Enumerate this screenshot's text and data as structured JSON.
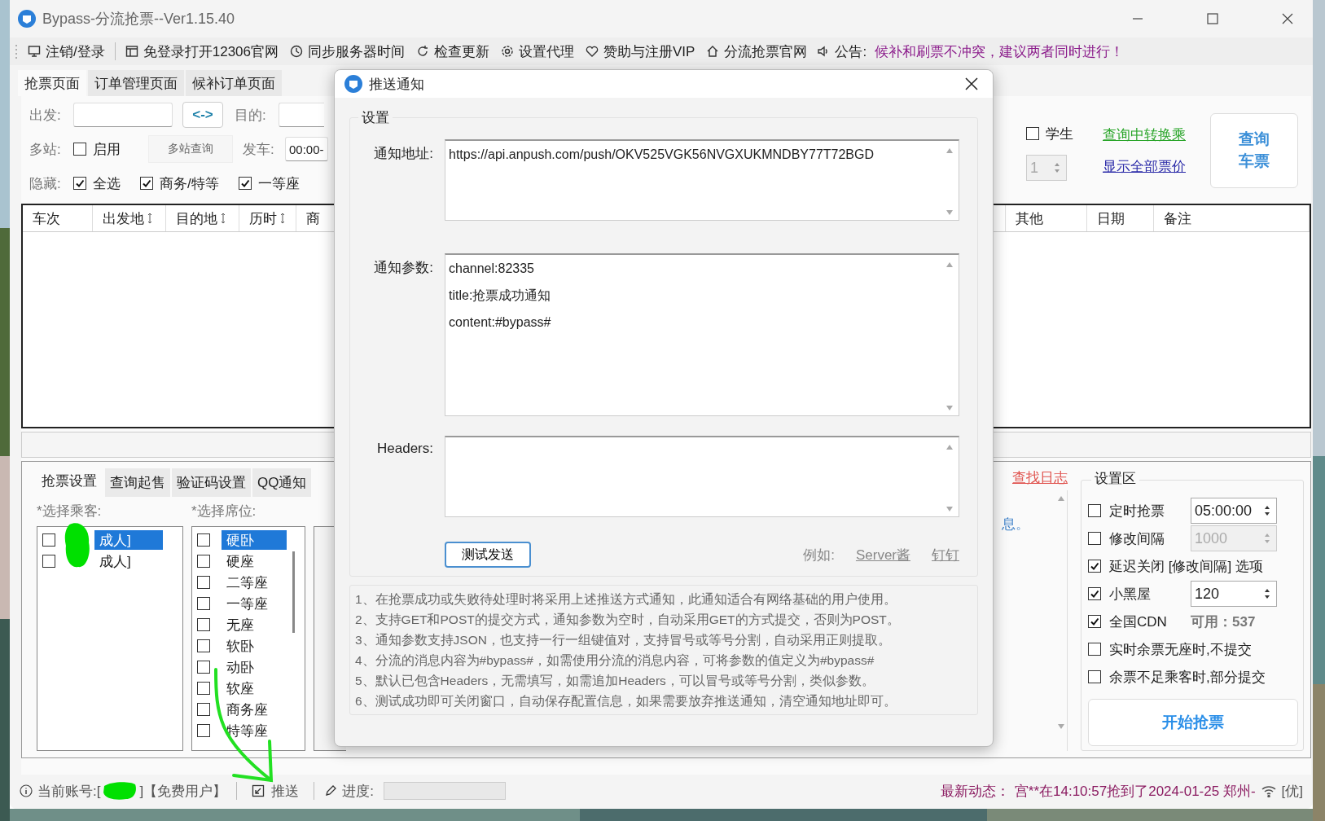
{
  "window": {
    "title": "Bypass-分流抢票--Ver1.15.40"
  },
  "toolbar": [
    "注销/登录",
    "免登录打开12306官网",
    "同步服务器时间",
    "检查更新",
    "设置代理",
    "赞助与注册VIP",
    "分流抢票官网"
  ],
  "announcement": {
    "label": "公告:",
    "text": "候补和刷票不冲突，建议两者同时进行！"
  },
  "main_tabs": [
    {
      "label": "抢票页面",
      "selected": true
    },
    {
      "label": "订单管理页面",
      "selected": false
    },
    {
      "label": "候补订单页面",
      "selected": false
    }
  ],
  "query": {
    "from_label": "出发:",
    "swap_button": "<->",
    "to_label": "目的:",
    "multi_label": "多站:",
    "multi_checkbox": {
      "label": "启用",
      "checked": false
    },
    "multi_button": "多站查询",
    "depart_label": "发车:",
    "depart_value": "00:00-",
    "hide_label": "隐藏:",
    "hide_options": [
      {
        "label": "全选",
        "checked": true
      },
      {
        "label": "商务/特等",
        "checked": true
      },
      {
        "label": "一等座",
        "checked": true
      }
    ],
    "student": {
      "label": "学生",
      "checked": false
    },
    "count_value": "1",
    "transfer_link": "查询中转换乘",
    "prices_link": "显示全部票价",
    "query_button": "查询车票"
  },
  "table": {
    "columns_left": [
      {
        "label": "车次",
        "sortable": false
      },
      {
        "label": "出发地",
        "sortable": true
      },
      {
        "label": "目的地",
        "sortable": true
      },
      {
        "label": "历时",
        "sortable": true
      },
      {
        "label": "商",
        "sortable": false
      }
    ],
    "columns_right": [
      {
        "label": "其他",
        "sortable": false
      },
      {
        "label": "日期",
        "sortable": false
      },
      {
        "label": "备注",
        "sortable": false
      }
    ]
  },
  "bottom_tabs": [
    {
      "label": "抢票设置",
      "selected": true
    },
    {
      "label": "查询起售",
      "selected": false
    },
    {
      "label": "验证码设置",
      "selected": false
    },
    {
      "label": "QQ通知",
      "selected": false
    }
  ],
  "passengers": {
    "label": "*选择乘客:",
    "items": [
      {
        "label": "成人]",
        "checked": false,
        "selected": true
      },
      {
        "label": "成人]",
        "checked": false,
        "selected": false
      }
    ]
  },
  "seats": {
    "label": "*选择席位:",
    "items": [
      {
        "label": "硬卧",
        "checked": false,
        "selected": true
      },
      {
        "label": "硬座",
        "checked": false,
        "selected": false
      },
      {
        "label": "二等座",
        "checked": false,
        "selected": false
      },
      {
        "label": "一等座",
        "checked": false,
        "selected": false
      },
      {
        "label": "无座",
        "checked": false,
        "selected": false
      },
      {
        "label": "软卧",
        "checked": false,
        "selected": false
      },
      {
        "label": "动卧",
        "checked": false,
        "selected": false
      },
      {
        "label": "软座",
        "checked": false,
        "selected": false
      },
      {
        "label": "商务座",
        "checked": false,
        "selected": false
      },
      {
        "label": "特等座",
        "checked": false,
        "selected": false
      }
    ]
  },
  "log": {
    "link": "查找日志",
    "text": "息。"
  },
  "settings": {
    "title": "设置区",
    "rows": [
      {
        "kind": "spinner",
        "label": "定时抢票",
        "checked": false,
        "value": "05:00:00",
        "disabled": false
      },
      {
        "kind": "spinner",
        "label": "修改间隔",
        "checked": false,
        "value": "1000",
        "disabled": true
      },
      {
        "kind": "plain",
        "label": "延迟关闭 [修改间隔] 选项",
        "checked": true
      },
      {
        "kind": "spinner",
        "label": "小黑屋",
        "checked": true,
        "value": "120",
        "disabled": false
      },
      {
        "kind": "info",
        "label": "全国CDN",
        "checked": true,
        "info": "可用：537"
      },
      {
        "kind": "plain",
        "label": "实时余票无座时,不提交",
        "checked": false
      },
      {
        "kind": "plain",
        "label": "余票不足乘客时,部分提交",
        "checked": false
      }
    ],
    "start_button": "开始抢票"
  },
  "status_bar": {
    "account_label": "当前账号:[",
    "account_suffix": "]【免费用户】",
    "push": "推送",
    "progress_label": "进度:",
    "news_label": "最新动态：",
    "news_text": "宫**在14:10:57抢到了2024-01-25 郑州-",
    "quality": "[优]"
  },
  "dialog": {
    "title": "推送通知",
    "group": "设置",
    "fields": [
      {
        "label": "通知地址:",
        "value": "https://api.anpush.com/push/OKV525VGK56NVGXUKMNDBY77T72BGD"
      },
      {
        "label": "通知参数:",
        "value": "channel:82335\ntitle:抢票成功通知\ncontent:#bypass#"
      },
      {
        "label": "Headers:"
      }
    ],
    "test_button": "测试发送",
    "example_label": "例如:",
    "example_links": [
      "Server酱",
      "钉钉"
    ],
    "notes": [
      "1、在抢票成功或失败待处理时将采用上述推送方式通知，此通知适合有网络基础的用户使用。",
      "2、支持GET和POST的提交方式，通知参数为空时，自动采用GET的方式提交，否则为POST。",
      "3、通知参数支持JSON，也支持一行一组键值对，支持冒号或等号分割，自动采用正则提取。",
      "4、分流的消息内容为#bypass#，如需使用分流的消息内容，可将参数的值定义为#bypass#",
      "5、默认已包含Headers，无需填写，如需追加Headers，可以冒号或等号分割，类似参数。",
      "6、测试成功即可关闭窗口，自动保存配置信息，如果需要放弃推送通知，清空通知地址即可。"
    ]
  }
}
